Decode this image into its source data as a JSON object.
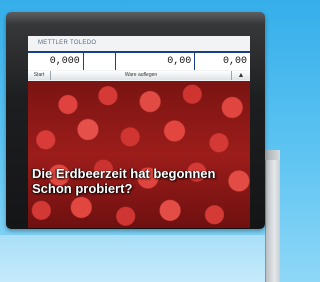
{
  "brand": "METTLER TOLEDO",
  "display": {
    "cells": [
      "0,000",
      "",
      "0,00",
      "0,00"
    ]
  },
  "toolbar": {
    "start_label": "Start",
    "center_label": "Ware auflegen",
    "arrow_label": "▲"
  },
  "promo": {
    "line1": "Die Erdbeerzeit hat begonnen",
    "line2": "Schon probiert?"
  }
}
